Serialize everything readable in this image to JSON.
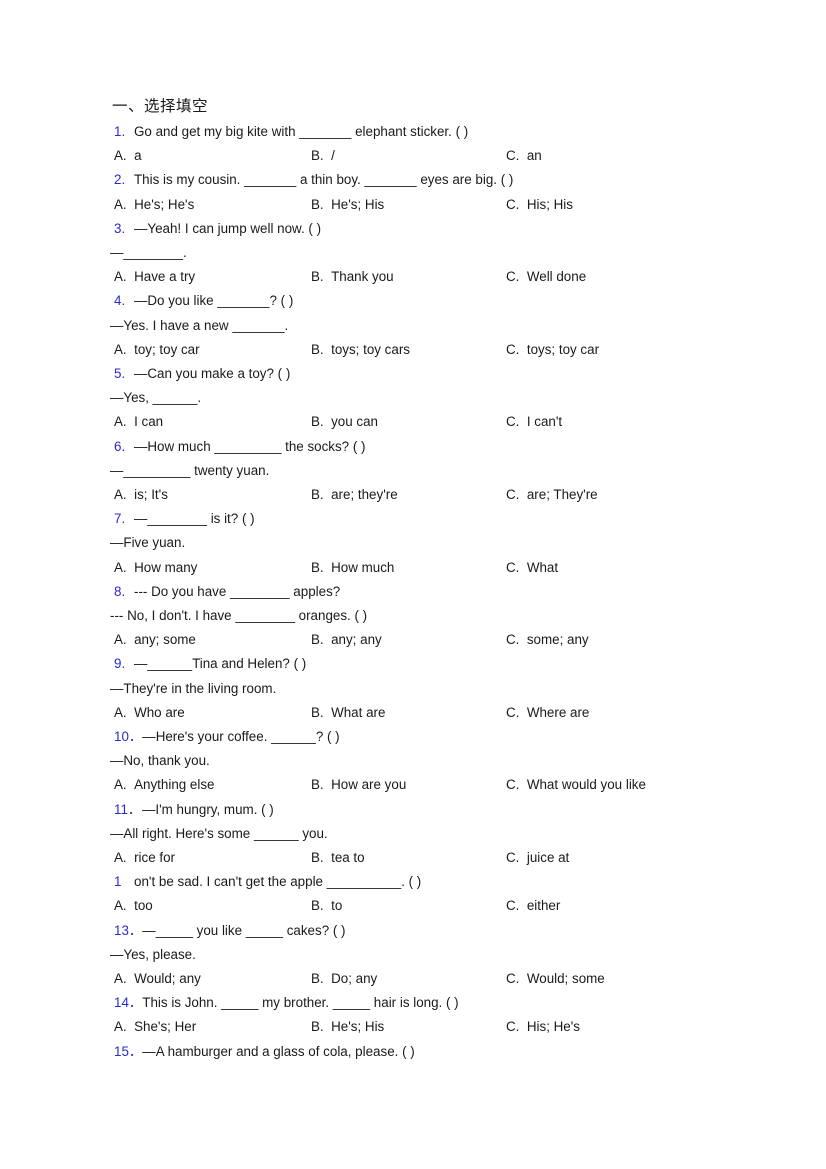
{
  "document": {
    "section_title": "一、选择填空",
    "background_color": "#ffffff",
    "number_color": "#2a2ad0",
    "text_color": "#1a1a1a"
  },
  "questions": [
    {
      "number": "1.",
      "stem": "Go and get my big kite with _______ elephant sticker. (   )",
      "reply": null,
      "options": [
        {
          "key": "A.",
          "text": "a"
        },
        {
          "key": "B.",
          "text": "/"
        },
        {
          "key": "C.",
          "text": "an"
        }
      ]
    },
    {
      "number": "2.",
      "stem": "This is my cousin. _______ a thin boy. _______ eyes are big. (   )",
      "reply": null,
      "options": [
        {
          "key": "A.",
          "text": "He's; He's"
        },
        {
          "key": "B.",
          "text": "He's; His"
        },
        {
          "key": "C.",
          "text": "His; His"
        }
      ]
    },
    {
      "number": "3.",
      "stem": "—Yeah! I can jump well now. (  )",
      "reply": "—________.",
      "options": [
        {
          "key": "A.",
          "text": "Have a try"
        },
        {
          "key": "B.",
          "text": "Thank you"
        },
        {
          "key": "C.",
          "text": "Well done"
        }
      ]
    },
    {
      "number": "4.",
      "stem": "—Do you like _______? (  )",
      "reply": "—Yes. I have a new _______.",
      "options": [
        {
          "key": "A.",
          "text": "toy; toy car"
        },
        {
          "key": "B.",
          "text": "toys; toy cars"
        },
        {
          "key": "C.",
          "text": "toys; toy car"
        }
      ]
    },
    {
      "number": "5.",
      "stem": "—Can you make a toy? (  )",
      "reply": "—Yes, ______.",
      "options": [
        {
          "key": "A.",
          "text": "I can"
        },
        {
          "key": "B.",
          "text": "you can"
        },
        {
          "key": "C.",
          "text": "I can't"
        }
      ]
    },
    {
      "number": "6.",
      "stem": "—How much _________ the socks? (  )",
      "reply": "—_________ twenty yuan.",
      "options": [
        {
          "key": "A.",
          "text": "is; It's"
        },
        {
          "key": "B.",
          "text": "are; they're"
        },
        {
          "key": "C.",
          "text": "are; They're"
        }
      ]
    },
    {
      "number": "7.",
      "stem": "—________ is it? (  )",
      "reply": "—Five yuan.",
      "options": [
        {
          "key": "A.",
          "text": "How many"
        },
        {
          "key": "B.",
          "text": "How much"
        },
        {
          "key": "C.",
          "text": "What"
        }
      ]
    },
    {
      "number": "8.",
      "stem": "--- Do you have ________ apples?",
      "reply": "--- No, I don't. I have ________ oranges. (  )",
      "options": [
        {
          "key": "A.",
          "text": "any; some"
        },
        {
          "key": "B.",
          "text": "any; any"
        },
        {
          "key": "C.",
          "text": "some; any"
        }
      ]
    },
    {
      "number": "9.",
      "stem": "—______Tina and Helen? (  )",
      "reply": "—They're in the living room.",
      "options": [
        {
          "key": "A.",
          "text": "Who are"
        },
        {
          "key": "B.",
          "text": "What are"
        },
        {
          "key": "C.",
          "text": "Where are"
        }
      ]
    },
    {
      "number": "10．",
      "stem": "—Here's your coffee. ______? (  )",
      "reply": "—No, thank you.",
      "options": [
        {
          "key": "A.",
          "text": "Anything else"
        },
        {
          "key": "B.",
          "text": "How are you"
        },
        {
          "key": "C.",
          "text": "What would you like"
        }
      ]
    },
    {
      "number": "11．",
      "stem": "—I'm hungry, mum. (  )",
      "reply": "—All right. Here's some ______ you.",
      "options": [
        {
          "key": "A.",
          "text": "rice for"
        },
        {
          "key": "B.",
          "text": "tea to"
        },
        {
          "key": "C.",
          "text": "juice at"
        }
      ]
    },
    {
      "number": "1",
      "stem": "on't be sad. I can't get the apple __________. (  )",
      "reply": null,
      "options": [
        {
          "key": "A.",
          "text": "too"
        },
        {
          "key": "B.",
          "text": "to"
        },
        {
          "key": "C.",
          "text": "either"
        }
      ]
    },
    {
      "number": "13．",
      "stem": "—_____ you like _____ cakes? (  )",
      "reply": "—Yes, please.",
      "options": [
        {
          "key": "A.",
          "text": "Would; any"
        },
        {
          "key": "B.",
          "text": "Do; any"
        },
        {
          "key": "C.",
          "text": "Would; some"
        }
      ]
    },
    {
      "number": "14．",
      "stem": "This is John. _____ my brother. _____ hair is long. (  )",
      "reply": null,
      "options": [
        {
          "key": "A.",
          "text": "She's; Her"
        },
        {
          "key": "B.",
          "text": "He's; His"
        },
        {
          "key": "C.",
          "text": "His; He's"
        }
      ]
    },
    {
      "number": "15．",
      "stem": "—A hamburger and a glass of cola, please. (  )",
      "reply": null,
      "options": []
    }
  ]
}
